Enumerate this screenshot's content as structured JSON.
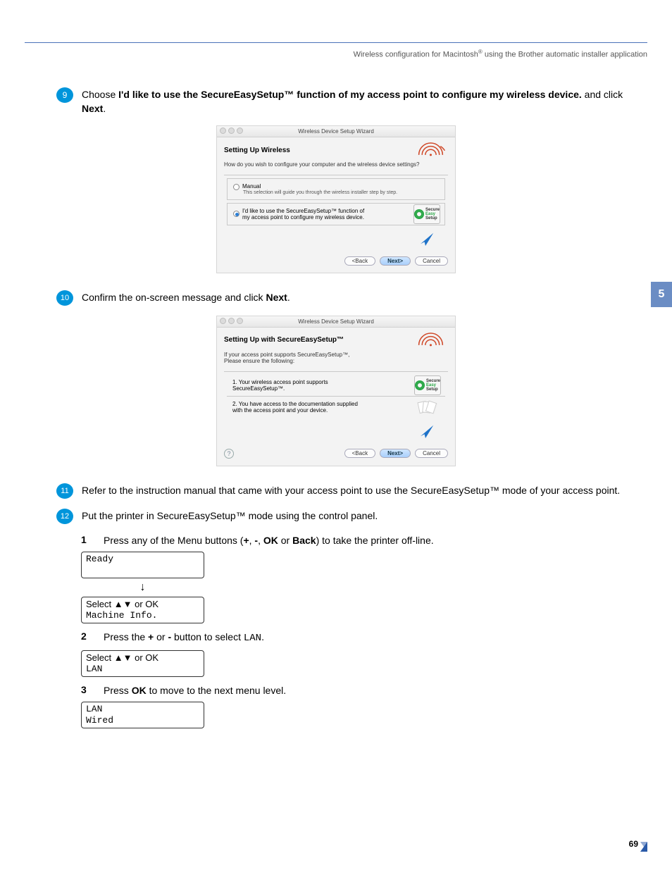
{
  "header": {
    "text_left": "Wireless configuration for Macintosh",
    "reg": "®",
    "text_right": " using the Brother automatic installer application"
  },
  "chapter_tab": "5",
  "steps": {
    "s9": {
      "num": "9",
      "pre": "Choose ",
      "bold": "I'd like to use the SecureEasySetup™ function of my access point to configure my wireless device.",
      "mid": " and click ",
      "bold2": "Next",
      "post": "."
    },
    "s10": {
      "num": "10",
      "pre": "Confirm the on-screen message and click ",
      "bold": "Next",
      "post": "."
    },
    "s11": {
      "num": "11",
      "text": "Refer to the instruction manual that came with your access point to use the SecureEasySetup™ mode of your access point."
    },
    "s12": {
      "num": "12",
      "text": "Put the printer in SecureEasySetup™ mode using the control panel."
    }
  },
  "wizard1": {
    "titlebar": "Wireless Device Setup Wizard",
    "heading": "Setting Up Wireless",
    "question": "How do you wish to configure your computer and the wireless device settings?",
    "opt1_label": "Manual",
    "opt1_sub": "This selection will guide you through the wireless installer step by step.",
    "opt2_label": "I'd like to use the SecureEasySetup™ function of my access point to configure my wireless device.",
    "ses": {
      "l1": "Secure",
      "l2": "Easy",
      "l3": "Setup"
    },
    "btn_back": "<Back",
    "btn_next": "Next>",
    "btn_cancel": "Cancel"
  },
  "wizard2": {
    "titlebar": "Wireless Device Setup Wizard",
    "heading": "Setting Up with SecureEasySetup™",
    "intro1": "If your access point supports SecureEasySetup™,",
    "intro2": "Please ensure the following:",
    "item1": "1. Your wireless access point supports SecureEasySetup™.",
    "item2": "2. You have access to the documentation supplied with the access point and your device.",
    "help": "?",
    "btn_back": "<Back",
    "btn_next": "Next>",
    "btn_cancel": "Cancel"
  },
  "substeps": {
    "ss1": {
      "num": "1",
      "pre": "Press any of the Menu buttons (",
      "b1": "+",
      "c1": ", ",
      "b2": "-",
      "c2": ", ",
      "b3": "OK",
      "c3": " or ",
      "b4": "Back",
      "post": ") to take the printer off-line."
    },
    "ss2": {
      "num": "2",
      "pre": "Press the ",
      "b1": "+",
      "mid": " or ",
      "b2": "-",
      "post": " button to select ",
      "code": "LAN",
      "end": "."
    },
    "ss3": {
      "num": "3",
      "pre": "Press ",
      "b1": "OK",
      "post": " to move to the next menu level."
    }
  },
  "lcd": {
    "ready": "Ready",
    "sel1a": "Select ▲▼ or OK",
    "sel1b": "Machine Info.",
    "sel2a": "Select ▲▼ or OK",
    "sel2b": "LAN",
    "sel3a": "LAN",
    "sel3b": "Wired"
  },
  "page_number": "69"
}
